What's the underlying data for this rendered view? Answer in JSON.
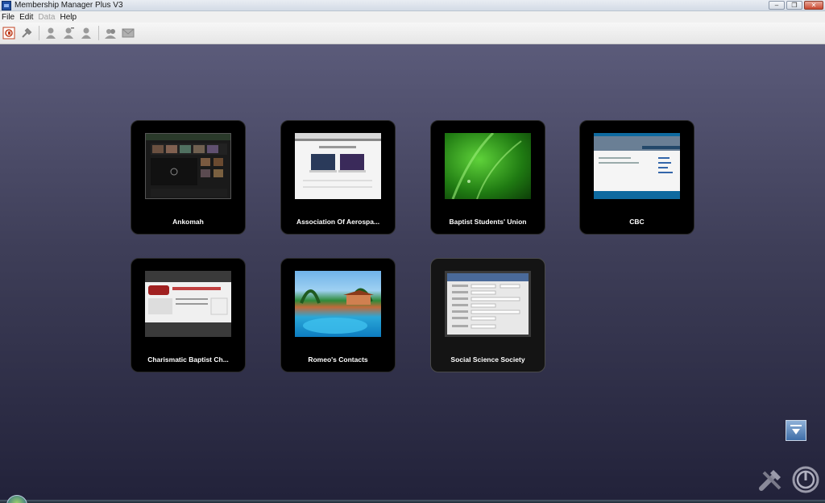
{
  "window": {
    "title": "Membership Manager Plus V3"
  },
  "menu": {
    "items": [
      {
        "label": "File",
        "enabled": true
      },
      {
        "label": "Edit",
        "enabled": true
      },
      {
        "label": "Data",
        "enabled": false
      },
      {
        "label": "Help",
        "enabled": true
      }
    ]
  },
  "toolbar": {
    "icons": [
      "new-database-icon",
      "wrench-icon",
      "person-icon",
      "person-add-icon",
      "person-remove-icon",
      "group-icon",
      "mail-icon"
    ]
  },
  "databases": [
    {
      "label": "Ankomah"
    },
    {
      "label": "Association Of Aerospa..."
    },
    {
      "label": "Baptist Students' Union"
    },
    {
      "label": "CBC"
    },
    {
      "label": "Charismatic Baptist Ch..."
    },
    {
      "label": "Romeo's Contacts"
    },
    {
      "label": "Social Science Society"
    }
  ],
  "colors": {
    "tile_background": "#000000",
    "background_top": "#5b5b7a",
    "background_bottom": "#22223a",
    "accent_blue": "#3f6ea8"
  }
}
